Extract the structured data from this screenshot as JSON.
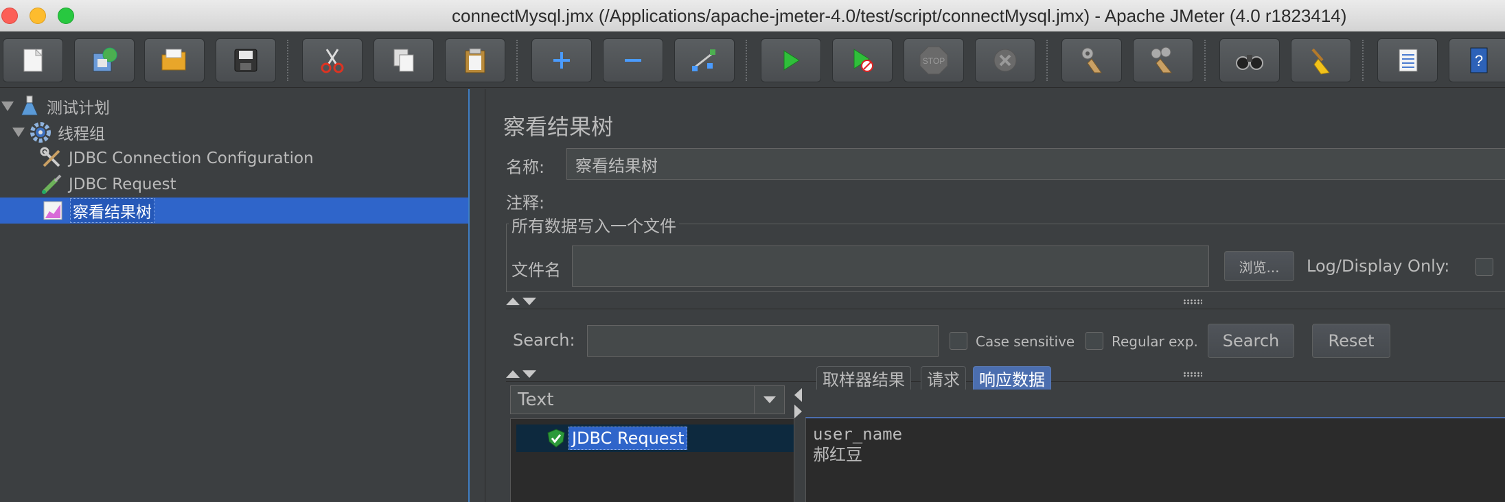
{
  "window": {
    "title": "connectMysql.jmx (/Applications/apache-jmeter-4.0/test/script/connectMysql.jmx) - Apache JMeter (4.0 r1823414)"
  },
  "toolbar": {
    "buttons": [
      {
        "name": "new-icon"
      },
      {
        "name": "templates-icon"
      },
      {
        "name": "open-icon"
      },
      {
        "name": "save-icon"
      },
      {
        "name": "cut-icon"
      },
      {
        "name": "copy-icon"
      },
      {
        "name": "paste-icon"
      },
      {
        "name": "expand-icon"
      },
      {
        "name": "collapse-icon"
      },
      {
        "name": "toggle-icon"
      },
      {
        "name": "start-icon"
      },
      {
        "name": "start-no-pauses-icon"
      },
      {
        "name": "stop-icon"
      },
      {
        "name": "shutdown-icon"
      },
      {
        "name": "clear-icon"
      },
      {
        "name": "clear-all-icon"
      },
      {
        "name": "search-icon"
      },
      {
        "name": "reset-search-icon"
      },
      {
        "name": "function-helper-icon"
      },
      {
        "name": "help-icon"
      }
    ],
    "stop_label": "STOP"
  },
  "tree": {
    "items": [
      {
        "label": "测试计划"
      },
      {
        "label": "线程组"
      },
      {
        "label": "JDBC Connection Configuration"
      },
      {
        "label": "JDBC Request"
      },
      {
        "label": "察看结果树",
        "selected": true
      }
    ]
  },
  "panel": {
    "title": "察看结果树",
    "name_label": "名称:",
    "name_value": "察看结果树",
    "comment_label": "注释:",
    "comment_value": "",
    "file_group_title": "所有数据写入一个文件",
    "filename_label": "文件名",
    "filename_value": "",
    "browse_label": "浏览...",
    "log_display_label": "Log/Display Only:",
    "search_label": "Search:",
    "search_value": "",
    "case_sensitive_label": "Case sensitive",
    "regular_exp_label": "Regular exp.",
    "search_button": "Search",
    "reset_button": "Reset",
    "renderer_selected": "Text",
    "result_item": "JDBC Request",
    "tabs": [
      {
        "label": "取样器结果",
        "active": false
      },
      {
        "label": "请求",
        "active": false
      },
      {
        "label": "响应数据",
        "active": true
      }
    ],
    "response_lines": [
      "user_name",
      "郝红豆"
    ]
  }
}
